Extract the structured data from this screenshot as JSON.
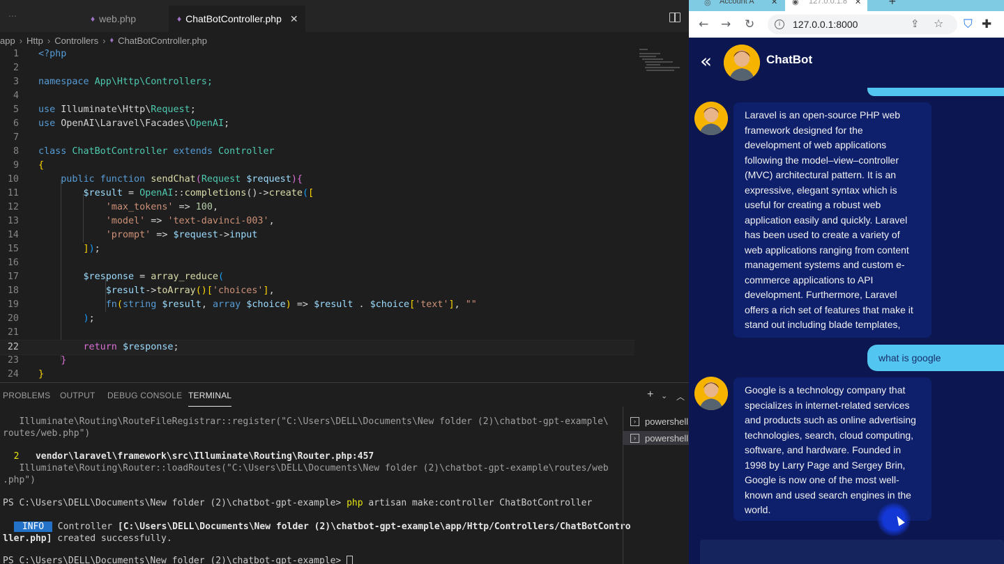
{
  "vscode": {
    "tabs": [
      {
        "label": "web.php",
        "icon": "php-icon",
        "active": false
      },
      {
        "label": "ChatBotController.php",
        "icon": "php-icon",
        "active": true
      }
    ],
    "breadcrumb": [
      "app",
      "Http",
      "Controllers",
      "ChatBotController.php"
    ],
    "line_numbers": [
      "1",
      "2",
      "3",
      "4",
      "5",
      "6",
      "7",
      "8",
      "9",
      "10",
      "11",
      "12",
      "13",
      "14",
      "15",
      "16",
      "17",
      "18",
      "19",
      "20",
      "21",
      "22",
      "23",
      "24"
    ],
    "code": {
      "l1": "<?php",
      "l3_kw": "namespace",
      "l3_ns": "App\\Http\\Controllers;",
      "l5_kw": "use",
      "l5_a": "Illuminate\\Http\\",
      "l5_b": "Request",
      "l5_c": ";",
      "l6_kw": "use",
      "l6_a": "OpenAI\\Laravel\\Facades\\",
      "l6_b": "OpenAI",
      "l6_c": ";",
      "l8_kw": "class",
      "l8_cls": "ChatBotController",
      "l8_ext": "extends",
      "l8_parent": "Controller",
      "l9": "{",
      "l10_pub": "public",
      "l10_fn": "function",
      "l10_name": "sendChat",
      "l10_open": "(",
      "l10_type": "Request",
      "l10_var": "$request",
      "l10_close": "){",
      "l11_var": "$result",
      "l11_eq": " = ",
      "l11_cls": "OpenAI",
      "l11_sep": "::",
      "l11_m1": "completions",
      "l11_p": "()->",
      "l11_m2": "create",
      "l11_open": "(",
      "l11_arr": "[",
      "l12_key": "'max_tokens'",
      "l12_arrow": " => ",
      "l12_val": "100",
      "l12_end": ",",
      "l13_key": "'model'",
      "l13_arrow": " => ",
      "l13_val": "'text-davinci-003'",
      "l13_end": ",",
      "l14_key": "'prompt'",
      "l14_arrow": " => ",
      "l14_var": "$request",
      "l14_acc": "->",
      "l14_prop": "input",
      "l15_arr": "]",
      "l15_close": ")",
      "l15_end": ";",
      "l17_var": "$response",
      "l17_eq": " = ",
      "l17_fn": "array_reduce",
      "l17_open": "(",
      "l18_var": "$result",
      "l18_acc": "->",
      "l18_fn": "toArray",
      "l18_p": "()",
      "l18_b1": "[",
      "l18_key": "'choices'",
      "l18_b2": "]",
      "l18_end": ",",
      "l19_fn": "fn",
      "l19_open": "(",
      "l19_t1": "string",
      "l19_v1": "$result",
      "l19_c": ", ",
      "l19_t2": "array",
      "l19_v2": "$choice",
      "l19_close": ")",
      "l19_arrow": " => ",
      "l19_v3": "$result",
      "l19_dot": " . ",
      "l19_v4": "$choice",
      "l19_b1": "[",
      "l19_key": "'text'",
      "l19_b2": "]",
      "l19_c2": ", ",
      "l19_str": "\"\"",
      "l20_close": ")",
      "l20_end": ";",
      "l22_kw": "return",
      "l22_var": "$response",
      "l22_end": ";",
      "l23": "}",
      "l24": "}"
    },
    "panel_tabs": [
      "PROBLEMS",
      "OUTPUT",
      "DEBUG CONSOLE",
      "TERMINAL"
    ],
    "active_panel": "TERMINAL",
    "terminal_lines": {
      "t1": "   Illuminate\\Routing\\RouteFileRegistrar::register(\"C:\\Users\\DELL\\Documents\\New folder (2)\\chatbot-gpt-example\\",
      "t2": "routes/web.php\")",
      "t3_num": "  2",
      "t3": "   vendor\\laravel\\framework\\src\\Illuminate\\Routing\\Router.php:457",
      "t4": "   Illuminate\\Routing\\Router::loadRoutes(\"C:\\Users\\DELL\\Documents\\New folder (2)\\chatbot-gpt-example\\routes/web",
      "t5": ".php\")",
      "t6_prompt": "PS C:\\Users\\DELL\\Documents\\New folder (2)\\chatbot-gpt-example> ",
      "t6_cmd": "php",
      "t6_args": " artisan make:controller ChatBotController",
      "t7_badge": " INFO ",
      "t7_a": " Controller ",
      "t7_b": "[C:\\Users\\DELL\\Documents\\New folder (2)\\chatbot-gpt-example\\app/Http/Controllers/ChatBotContro",
      "t8_b": "ller.php]",
      "t8_c": " created successfully.",
      "t9_prompt": "PS C:\\Users\\DELL\\Documents\\New folder (2)\\chatbot-gpt-example> "
    },
    "terminals": [
      "powershell",
      "powershell"
    ]
  },
  "browser": {
    "tabs": [
      "Account A",
      "127.0.0.1:8"
    ],
    "url": "127.0.0.1:8000",
    "chat": {
      "title": "ChatBot",
      "messages": [
        {
          "role": "bot",
          "text": "Laravel is an open-source PHP web framework designed for the development of web applications following the model–view–controller (MVC) architectural pattern. It is an expressive, elegant syntax which is useful for creating a robust web application easily and quickly. Laravel has been used to create a variety of web applications ranging from content management systems and custom e-commerce applications to API development. Furthermore, Laravel offers a rich set of features that make it stand out including blade templates,"
        },
        {
          "role": "user",
          "text": "what is google"
        },
        {
          "role": "bot",
          "text": "Google is a technology company that specializes in internet-related services and products such as online advertising technologies, search, cloud computing, software, and hardware. Founded in 1998 by Larry Page and Sergey Brin, Google is now one of the most well-known and used search engines in the world."
        }
      ]
    },
    "colors": {
      "chat_bg": "#0c1650",
      "bot_bubble": "#0e1f6b",
      "user_bubble": "#52c5f0",
      "avatar_bg": "#f6b400"
    }
  }
}
